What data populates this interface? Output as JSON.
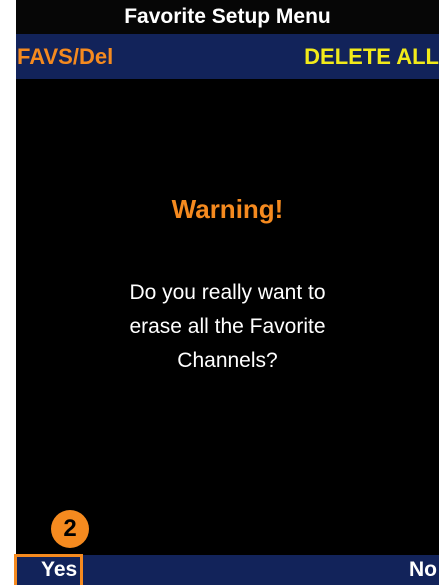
{
  "header": {
    "title": "Favorite Setup Menu"
  },
  "subheader": {
    "left_label": "FAVS/Del",
    "right_label": "DELETE ALL"
  },
  "dialog": {
    "title": "Warning!",
    "message_lines": [
      "Do you really want to",
      "erase all the Favorite",
      "Channels?"
    ]
  },
  "annotation": {
    "step_number": "2"
  },
  "softkeys": {
    "left": "Yes",
    "right": "No"
  },
  "colors": {
    "orange": "#f58a1f",
    "yellow": "#f2ea1a",
    "navy": "#12235a",
    "background": "#000000",
    "text": "#ffffff"
  }
}
